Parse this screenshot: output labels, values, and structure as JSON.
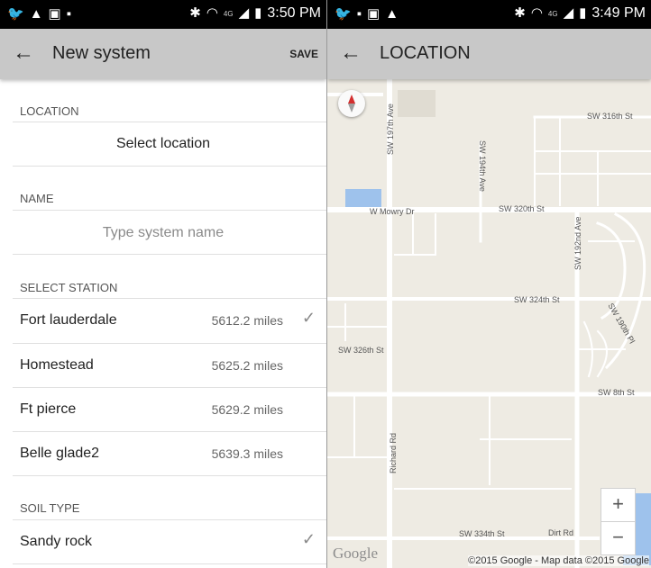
{
  "left_screen": {
    "status_bar": {
      "time": "3:50 PM",
      "network": "4G"
    },
    "app_bar": {
      "back_icon": "arrow-left-icon",
      "title": "New system",
      "action": "SAVE"
    },
    "location": {
      "header": "LOCATION",
      "placeholder": "Select location"
    },
    "name": {
      "header": "NAME",
      "placeholder": "Type system name"
    },
    "stations": {
      "header": "SELECT STATION",
      "items": [
        {
          "name": "Fort lauderdale",
          "distance": "5612.2 miles",
          "selected": true
        },
        {
          "name": "Homestead",
          "distance": "5625.2 miles",
          "selected": false
        },
        {
          "name": "Ft pierce",
          "distance": "5629.2 miles",
          "selected": false
        },
        {
          "name": "Belle glade2",
          "distance": "5639.3 miles",
          "selected": false
        }
      ]
    },
    "soil": {
      "header": "SOIL TYPE",
      "value": "Sandy rock",
      "selected": true
    }
  },
  "right_screen": {
    "status_bar": {
      "time": "3:49 PM",
      "network": "4G"
    },
    "app_bar": {
      "back_icon": "arrow-left-icon",
      "title": "LOCATION"
    },
    "map": {
      "streets": {
        "sw_316th": "SW 316th St",
        "sw_197th": "SW 197th Ave",
        "sw_194th": "SW 194th Ave",
        "w_mowry": "W Mowry Dr",
        "sw_320th": "SW 320th St",
        "sw_192nd": "SW 192nd Ave",
        "sw_324th": "SW 324th St",
        "sw_190th_pl": "SW 190th Pl",
        "sw_326th": "SW 326th St",
        "sw_8th": "SW 8th St",
        "richard_rd": "Richard Rd",
        "sw_334th": "SW 334th St",
        "dirt_rd": "Dirt Rd"
      },
      "zoom_in": "+",
      "zoom_out": "−",
      "logo": "Google",
      "attribution": "©2015 Google - Map data ©2015 Google"
    }
  },
  "colors": {
    "app_bar": "#c8c8c8",
    "map_bg": "#eeebe3",
    "road": "#ffffff",
    "water": "#9ec2ec"
  }
}
